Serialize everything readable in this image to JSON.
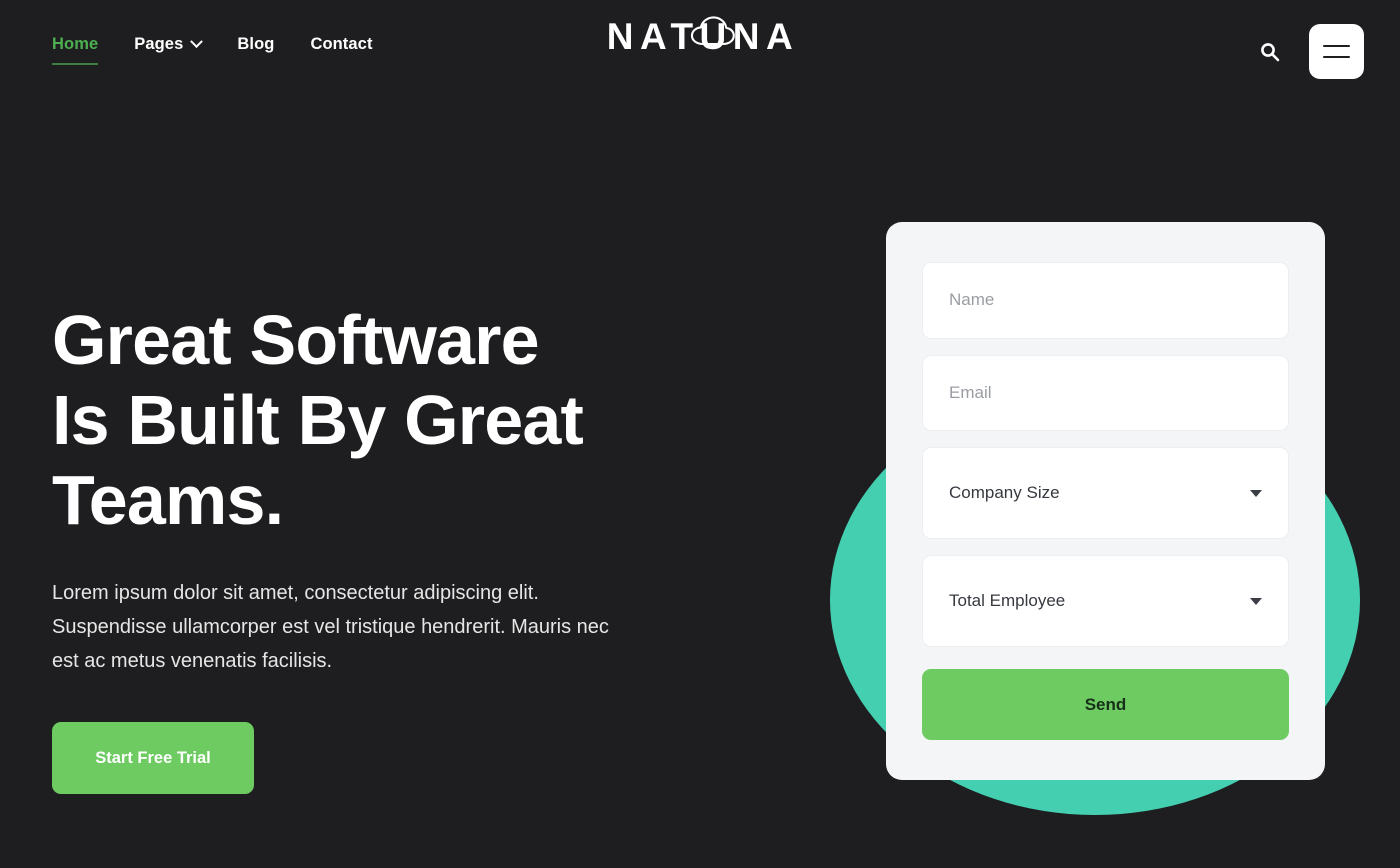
{
  "header": {
    "nav": [
      {
        "label": "Home",
        "active": true,
        "has_dropdown": false
      },
      {
        "label": "Pages",
        "active": false,
        "has_dropdown": true
      },
      {
        "label": "Blog",
        "active": false,
        "has_dropdown": false
      },
      {
        "label": "Contact",
        "active": false,
        "has_dropdown": false
      }
    ],
    "logo": {
      "text": "NATUNA",
      "icon": "cloud-icon"
    },
    "search_icon": "search-icon",
    "menu_icon": "hamburger-menu-icon"
  },
  "hero": {
    "headline_line1": "Great Software",
    "headline_line2": "Is Built By Great",
    "headline_line3": "Teams.",
    "paragraph": "Lorem ipsum dolor sit amet, consectetur adipiscing elit. Suspendisse ullamcorper est vel tristique hendrerit. Mauris nec est ac metus venenatis facilisis.",
    "cta_label": "Start Free Trial"
  },
  "form": {
    "name_placeholder": "Name",
    "name_value": "",
    "email_placeholder": "Email",
    "email_value": "",
    "company_size_label": "Company Size",
    "total_employee_label": "Total Employee",
    "submit_label": "Send"
  },
  "colors": {
    "background": "#1e1e20",
    "accent_green": "#6ecb62",
    "nav_active_green": "#4caf50",
    "teal_circle": "#45cfb1",
    "card_background": "#f4f5f7",
    "text_white": "#ffffff",
    "placeholder_gray": "#9a9da3"
  }
}
